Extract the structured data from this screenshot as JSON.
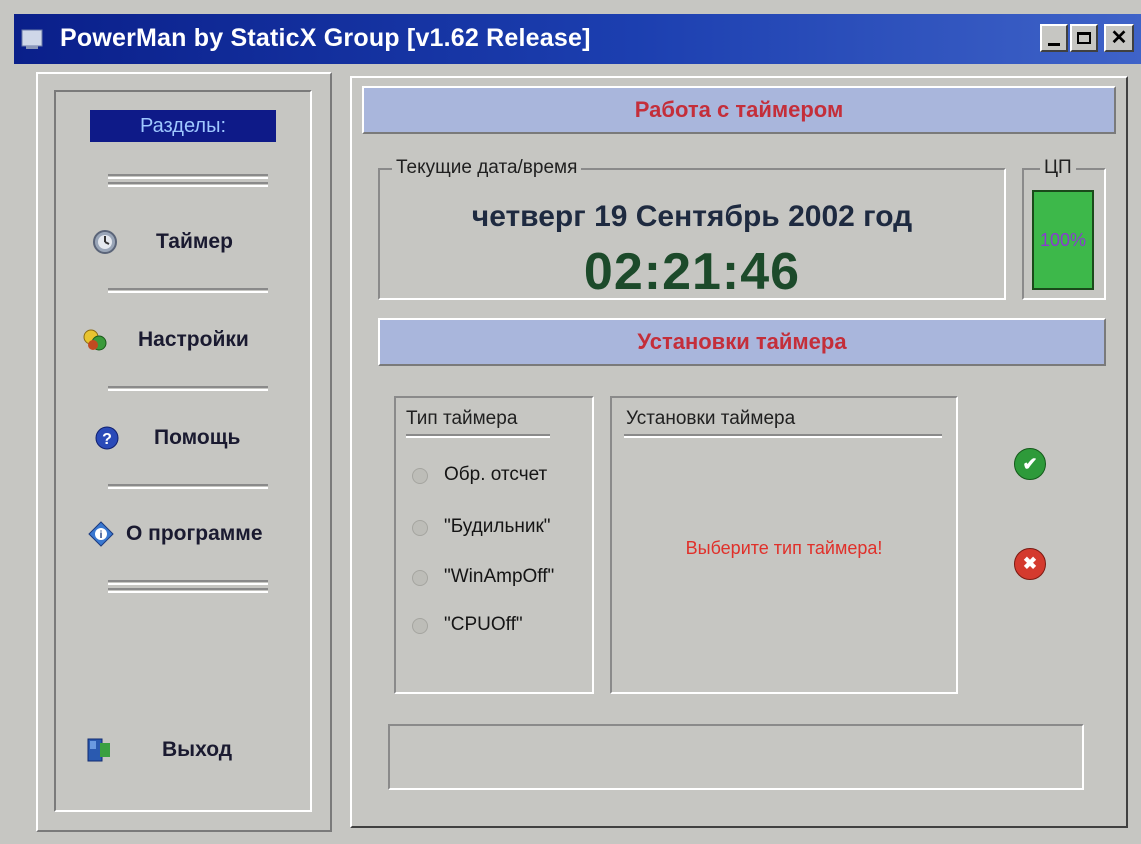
{
  "window": {
    "title": "PowerMan by StaticX Group [v1.62 Release]",
    "controls": [
      "minimize-icon",
      "maximize-icon",
      "close-icon"
    ]
  },
  "sidebar": {
    "header": "Разделы:",
    "items": [
      {
        "label": "Таймер",
        "icon": "clock-icon"
      },
      {
        "label": "Настройки",
        "icon": "settings-icon"
      },
      {
        "label": "Помощь",
        "icon": "help-icon"
      },
      {
        "label": "О программе",
        "icon": "info-icon"
      },
      {
        "label": "Выход",
        "icon": "exit-icon"
      }
    ]
  },
  "main": {
    "banner_title": "Работа с таймером",
    "datetime_group_label": "Текущие дата/время",
    "date": "четверг 19 Сентябрь 2002 год",
    "time": "02:21:46",
    "cpu_label": "ЦП",
    "cpu_value": "100%",
    "settings_banner": "Установки таймера",
    "timer_type": {
      "header": "Тип таймера",
      "options": [
        "Обр. отсчет",
        "\"Будильник\"",
        "\"WinAmpOff\"",
        "\"CPUOff\""
      ]
    },
    "timer_settings": {
      "header": "Установки таймера",
      "hint": "Выберите тип таймера!"
    },
    "actions": {
      "confirm": "check-icon",
      "cancel": "cancel-icon"
    }
  },
  "colors": {
    "title_bar": "#0a1f8a",
    "banner_bg": "#a9b6dc",
    "banner_text": "#c42e3a",
    "cpu_fill": "#3db84a",
    "hint_text": "#e0302a",
    "time_text": "#1c4a2a"
  }
}
